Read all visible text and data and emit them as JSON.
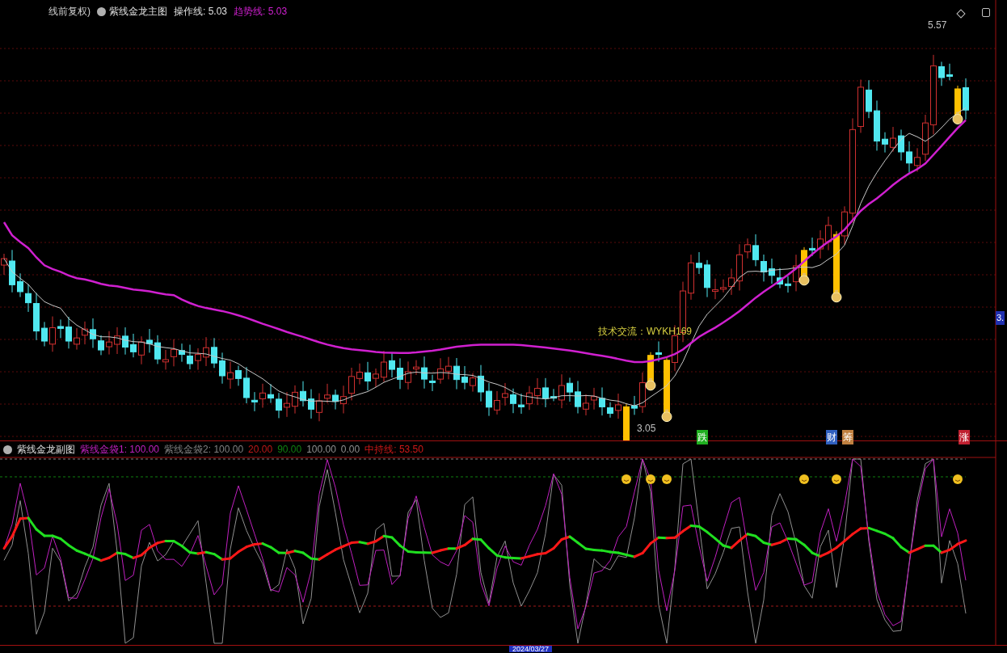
{
  "main_chart": {
    "title_fragment": "线前复权)",
    "indicator": "紫线金龙主图",
    "fields": [
      {
        "label": "操作线:",
        "value": "5.03",
        "color": "#e0e0e0"
      },
      {
        "label": "趋势线:",
        "value": "5.03",
        "color": "#d020d0"
      }
    ],
    "note": "技术交流：WYKH169",
    "high_label": "5.57",
    "low_label": "3.05",
    "price_tag": "3.",
    "markers": [
      {
        "text": "跌",
        "color": "#20b020"
      },
      {
        "text": "财",
        "color": "#3060c0"
      },
      {
        "text": "筹",
        "color": "#c08040"
      },
      {
        "text": "涨",
        "color": "#c02030"
      }
    ]
  },
  "sub_chart": {
    "indicator": "紫线金龙副图",
    "fields": [
      {
        "text": "紫线金袋1: 100.00",
        "color": "#c020c0"
      },
      {
        "text": "紫线金袋2: 100.00",
        "color": "#808080"
      },
      {
        "text": "20.00",
        "color": "#c01818"
      },
      {
        "text": "90.00",
        "color": "#108010"
      },
      {
        "text": "100.00",
        "color": "#909090"
      },
      {
        "text": "0.00",
        "color": "#909090"
      },
      {
        "text": "中持线: 53.50",
        "color": "#d01818"
      }
    ]
  },
  "time_axis": {
    "date": "2024/03/27"
  }
}
